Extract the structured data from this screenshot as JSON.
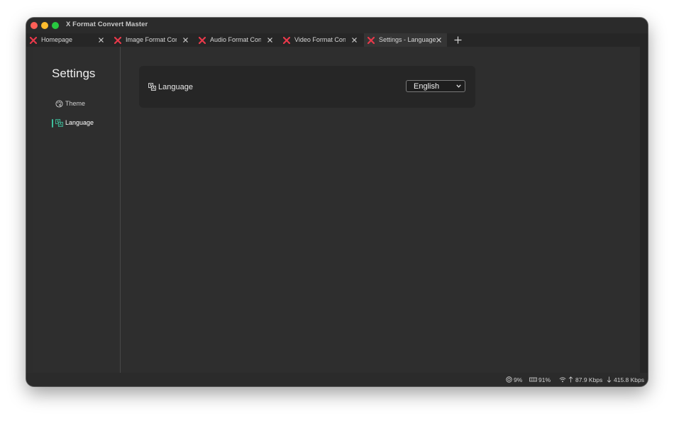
{
  "window": {
    "title": "X Format Convert Master"
  },
  "tabs": [
    {
      "label": "Homepage",
      "active": false
    },
    {
      "label": "Image Format Conve",
      "active": false
    },
    {
      "label": "Audio Format Conve",
      "active": false
    },
    {
      "label": "Video Format Conve",
      "active": false
    },
    {
      "label": "Settings - Language",
      "active": true
    }
  ],
  "sidebar": {
    "title": "Settings",
    "items": [
      {
        "label": "Theme",
        "icon": "palette-icon",
        "selected": false
      },
      {
        "label": "Language",
        "icon": "translate-icon",
        "selected": true
      }
    ]
  },
  "language_setting": {
    "label": "Language",
    "selected": "English"
  },
  "status": {
    "cpu": "9%",
    "memory": "91%",
    "upload": "87.9 Kbps",
    "download": "415.8 Kbps"
  },
  "colors": {
    "logo_red": "#e8394a",
    "accent_teal": "#3fbf9c",
    "window_bg": "#2d2d2d"
  }
}
